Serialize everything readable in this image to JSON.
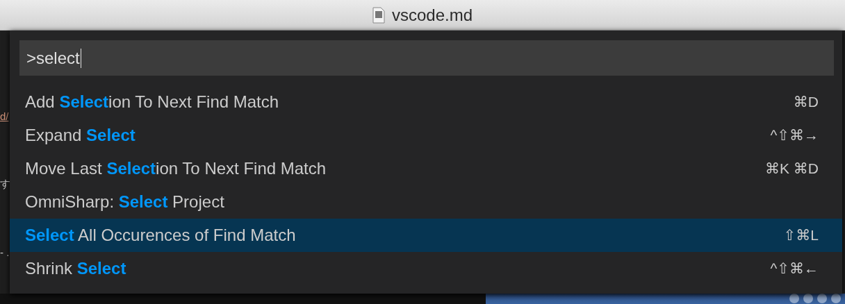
{
  "window": {
    "title": "vscode.md"
  },
  "editor_fragments": [
    {
      "text": "d/",
      "kind": "link"
    },
    {
      "text": "す",
      "kind": "plain"
    },
    {
      "text": "- .",
      "kind": "plain"
    }
  ],
  "command_palette": {
    "input": {
      "value": ">select"
    },
    "items": [
      {
        "label": "Add **Select**ion To Next Find Match",
        "shortcut": "⌘D",
        "selected": false
      },
      {
        "label": "Expand **Select**",
        "shortcut": "^⇧⌘→",
        "selected": false
      },
      {
        "label": "Move Last **Select**ion To Next Find Match",
        "shortcut": "⌘K ⌘D",
        "selected": false
      },
      {
        "label": "OmniSharp: **Select** Project",
        "selected": false
      },
      {
        "label": "**Select** All Occurences of Find Match",
        "shortcut": "⇧⌘L",
        "selected": true
      },
      {
        "label": "Shrink **Select**",
        "shortcut": "^⇧⌘←",
        "selected": false
      }
    ]
  }
}
